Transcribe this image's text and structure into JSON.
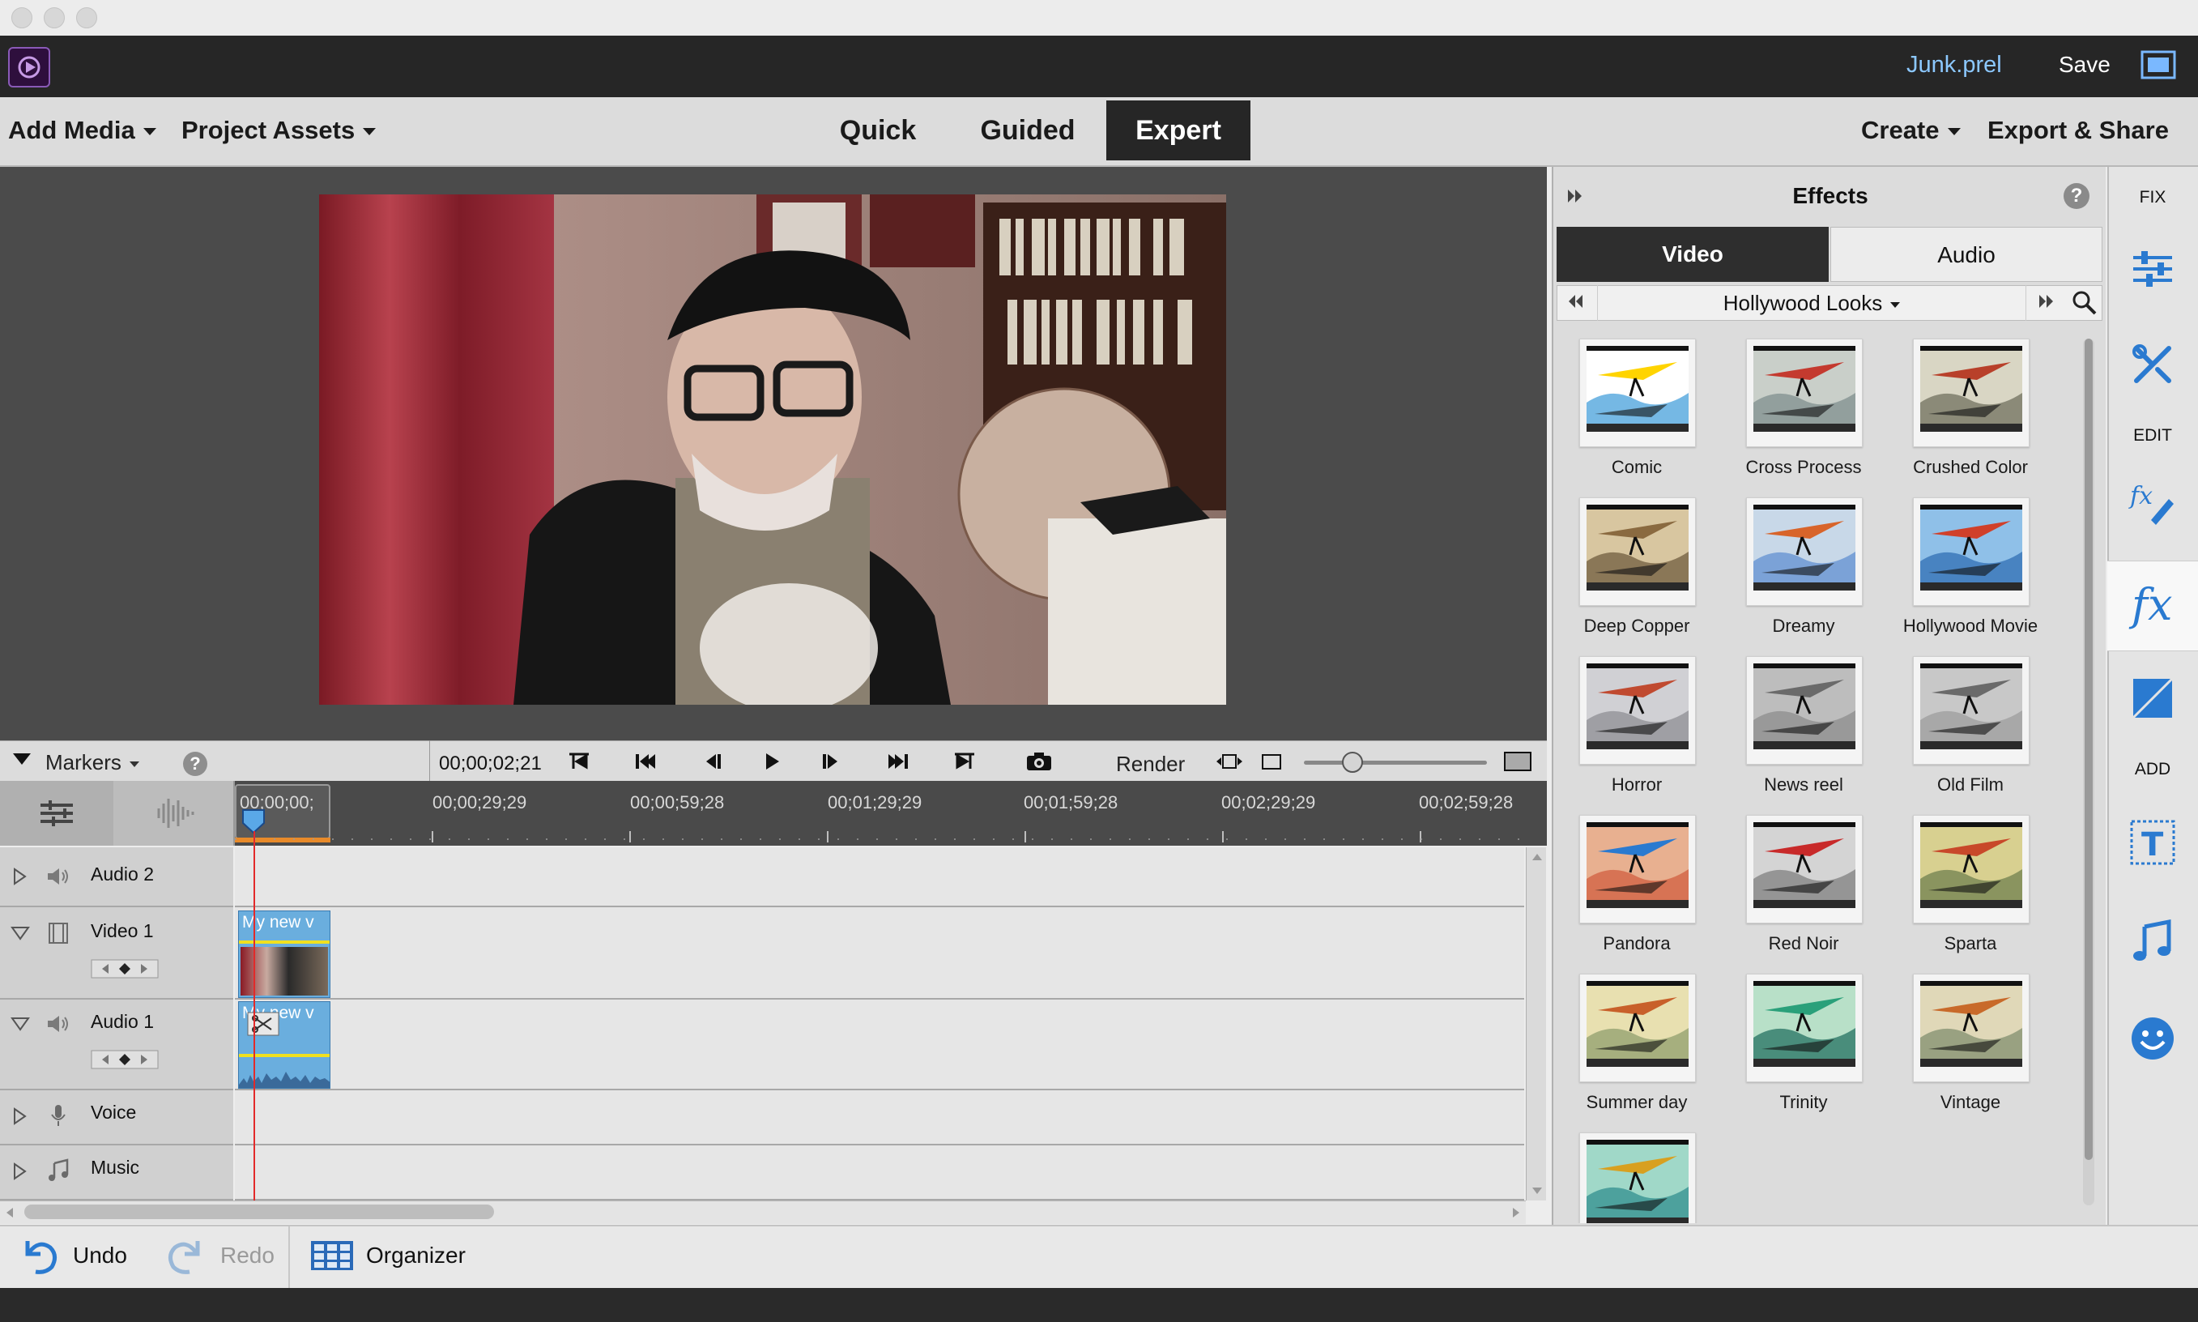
{
  "app": {
    "project_name": "Junk.prel",
    "save_label": "Save"
  },
  "menubar": {
    "add_media": "Add Media",
    "project_assets": "Project Assets",
    "modes": [
      "Quick",
      "Guided",
      "Expert"
    ],
    "active_mode": "Expert",
    "create": "Create",
    "export_share": "Export & Share"
  },
  "transport": {
    "markers_label": "Markers",
    "timecode": "00;00;02;21",
    "render_label": "Render",
    "zoom_level": 0.17
  },
  "timeline": {
    "ruler": [
      "00;00;00;",
      "00;00;29;29",
      "00;00;59;28",
      "00;01;29;29",
      "00;01;59;28",
      "00;02;29;29",
      "00;02;59;28"
    ],
    "tracks": [
      {
        "name": "Audio 2"
      },
      {
        "name": "Video 1",
        "clip": "My new v"
      },
      {
        "name": "Audio 1",
        "clip": "My new v"
      },
      {
        "name": "Voice"
      },
      {
        "name": "Music"
      }
    ]
  },
  "effects": {
    "title": "Effects",
    "tabs": [
      "Video",
      "Audio"
    ],
    "active_tab": "Video",
    "category": "Hollywood Looks",
    "items": [
      {
        "label": "Comic",
        "colors": [
          "#ffd400",
          "#3a9ad9",
          "#ffffff"
        ]
      },
      {
        "label": "Cross Process",
        "colors": [
          "#c43a2f",
          "#7a8a8a",
          "#c9cfc9"
        ]
      },
      {
        "label": "Crushed Color",
        "colors": [
          "#b8402a",
          "#6a6a58",
          "#d9d6c4"
        ]
      },
      {
        "label": "Deep Copper",
        "colors": [
          "#8a6a40",
          "#6a5638",
          "#d8c6a0"
        ]
      },
      {
        "label": "Dreamy",
        "colors": [
          "#d8642a",
          "#5a8cd0",
          "#c8d8e8"
        ]
      },
      {
        "label": "Hollywood Movie",
        "colors": [
          "#d0402a",
          "#2a6ab0",
          "#8fc0e8"
        ]
      },
      {
        "label": "Horror",
        "colors": [
          "#c04a30",
          "#8a8a90",
          "#d0d0d4"
        ]
      },
      {
        "label": "News reel",
        "colors": [
          "#6a6a6a",
          "#8a8a8a",
          "#bdbdbd"
        ]
      },
      {
        "label": "Old Film",
        "colors": [
          "#6a6a6a",
          "#9a9a9a",
          "#c8c8c8"
        ]
      },
      {
        "label": "Pandora",
        "colors": [
          "#2a7ad0",
          "#d05a3a",
          "#e8b090"
        ]
      },
      {
        "label": "Red Noir",
        "colors": [
          "#c82a2a",
          "#7a7a7a",
          "#d4d4d4"
        ]
      },
      {
        "label": "Sparta",
        "colors": [
          "#c8482a",
          "#6a7a4a",
          "#d8d090"
        ]
      },
      {
        "label": "Summer day",
        "colors": [
          "#c8602a",
          "#8a9a6a",
          "#e8e0b0"
        ]
      },
      {
        "label": "Trinity",
        "colors": [
          "#2aa07a",
          "#1a6a5a",
          "#b8e0c8"
        ]
      },
      {
        "label": "Vintage",
        "colors": [
          "#c86a2a",
          "#7a8a6a",
          "#e0d8b8"
        ]
      },
      {
        "label": "",
        "colors": [
          "#d8a020",
          "#2a8a8a",
          "#a0d8c8"
        ]
      }
    ]
  },
  "tools": {
    "fix": "FIX",
    "edit": "EDIT",
    "add": "ADD"
  },
  "bottombar": {
    "undo": "Undo",
    "redo": "Redo",
    "organizer": "Organizer"
  }
}
